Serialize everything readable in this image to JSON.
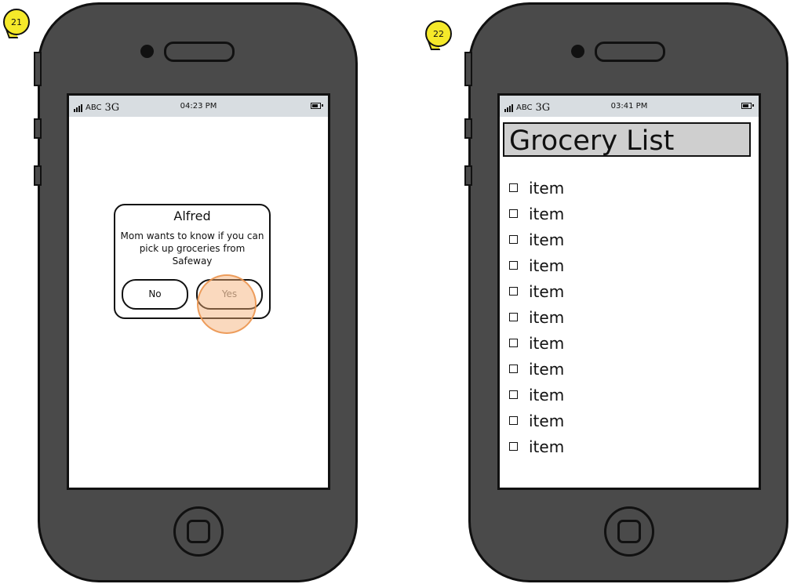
{
  "badges": [
    "21",
    "22"
  ],
  "screen1": {
    "status": {
      "carrier": "ABC",
      "network": "3G",
      "time": "04:23 PM"
    },
    "dialog": {
      "title": "Alfred",
      "message": "Mom wants to know if you can pick up groceries from Safeway",
      "no_label": "No",
      "yes_label": "Yes"
    }
  },
  "screen2": {
    "status": {
      "carrier": "ABC",
      "network": "3G",
      "time": "03:41 PM"
    },
    "title": "Grocery List",
    "items": [
      "item",
      "item",
      "item",
      "item",
      "item",
      "item",
      "item",
      "item",
      "item",
      "item",
      "item"
    ]
  },
  "colors": {
    "phone_body": "#4a4a4a",
    "status_bar": "#d8dde1",
    "badge": "#f5e92a",
    "tap_highlight": "#f5aa6e",
    "title_bar": "#cfcfcf"
  },
  "icons": [
    "signal-icon",
    "battery-icon",
    "checkbox-icon",
    "home-button-icon"
  ]
}
